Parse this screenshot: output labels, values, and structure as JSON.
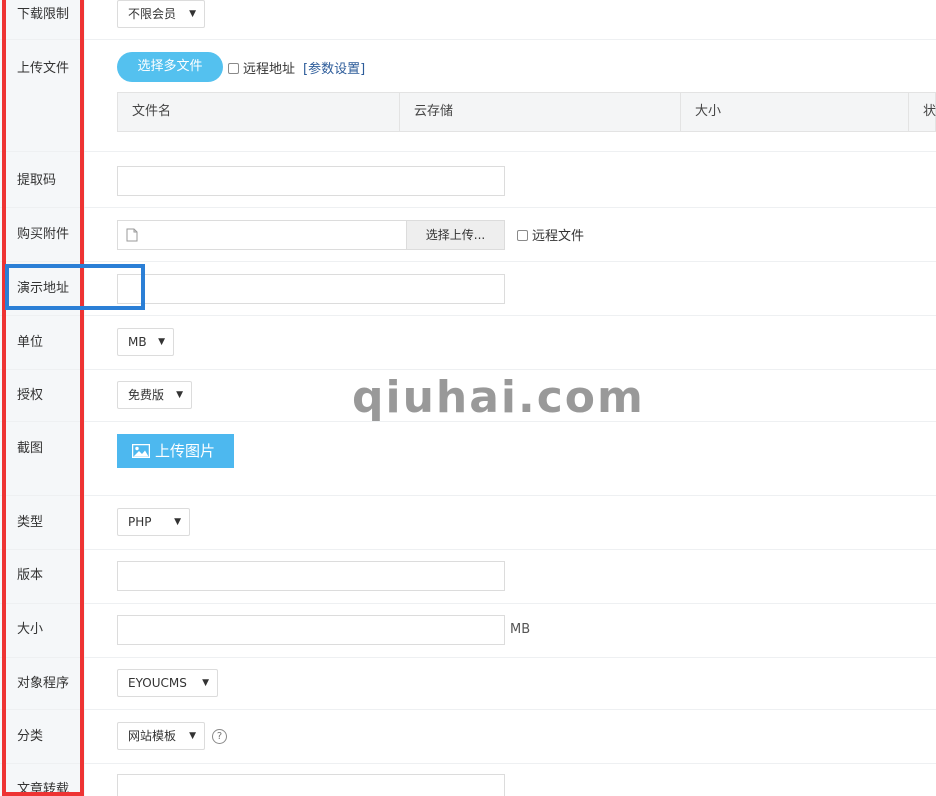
{
  "fields": {
    "download_limit": {
      "label": "下载限制",
      "value": "不限会员"
    },
    "upload_file": {
      "label": "上传文件",
      "button": "选择多文件",
      "remote_checkbox": "远程地址",
      "params_link": "[参数设置]",
      "table_headers": [
        "文件名",
        "云存储",
        "大小",
        "状"
      ]
    },
    "extract_code": {
      "label": "提取码",
      "value": ""
    },
    "buy_attachment": {
      "label": "购买附件",
      "button": "选择上传...",
      "remote_checkbox": "远程文件"
    },
    "demo_url": {
      "label": "演示地址",
      "value": ""
    },
    "unit": {
      "label": "单位",
      "value": "MB"
    },
    "license": {
      "label": "授权",
      "value": "免费版"
    },
    "screenshot": {
      "label": "截图",
      "button": "上传图片"
    },
    "type": {
      "label": "类型",
      "value": "PHP"
    },
    "version": {
      "label": "版本",
      "value": ""
    },
    "size": {
      "label": "大小",
      "value": "",
      "unit": "MB"
    },
    "target_program": {
      "label": "对象程序",
      "value": "EYOUCMS"
    },
    "category": {
      "label": "分类",
      "value": "网站模板"
    },
    "article_repost": {
      "label": "文章转载",
      "value": ""
    }
  },
  "watermark": "qiuhai.com",
  "colors": {
    "annotation_red": "#ee3333",
    "annotation_blue": "#2b7fd6",
    "accent_blue": "#54c1ef"
  }
}
